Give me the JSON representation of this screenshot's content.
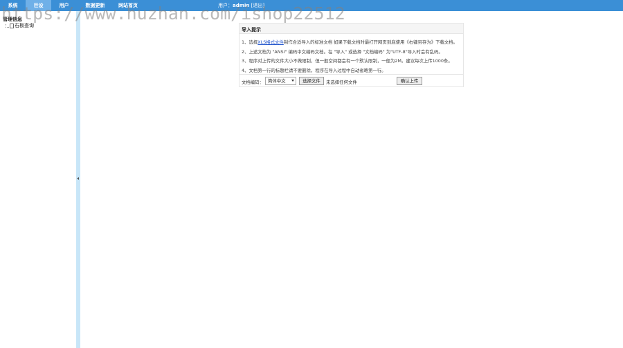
{
  "header": {
    "nav": [
      {
        "label": "系统"
      },
      {
        "label": "巨设"
      },
      {
        "label": "用户"
      },
      {
        "label": "数据更新"
      },
      {
        "label": "网站首页"
      }
    ],
    "user_prefix": "用户：",
    "username": "admin",
    "logout_label": "[退出]"
  },
  "watermark": "https://www.huzhan.com/ishop22512",
  "sidebar": {
    "title": "管理信息",
    "items": [
      {
        "label": "石板查询"
      }
    ]
  },
  "panel": {
    "title": "导入提示",
    "tips": [
      {
        "pre": "1、选择",
        "link": "XLS格式文件",
        "post": "制作合适导入的标准文档 如果下载文档时最打开网页到底使用《右键另存为》下载文档。"
      },
      {
        "text": "2、上述文档为 \"ANSI\" 编码中文编码文档。在 \"导入\" 或选择 \"文档编码\" 为\"UTF-8\"导入时会有乱码。"
      },
      {
        "text": "3、程序对上传的文件大小不做限制，但一般空间都会有一个默认限制，一般为2M。建议每次上传1000条。"
      },
      {
        "text": "4、文档第一行的标题栏请不要删除，程序在导入过程中自动省略第一行。"
      }
    ],
    "encoding_label": "文档编码：",
    "encoding_value": "简体中文",
    "choose_file_label": "选择文件",
    "file_status": "未选择任何文件",
    "upload_label": "确认上传"
  }
}
